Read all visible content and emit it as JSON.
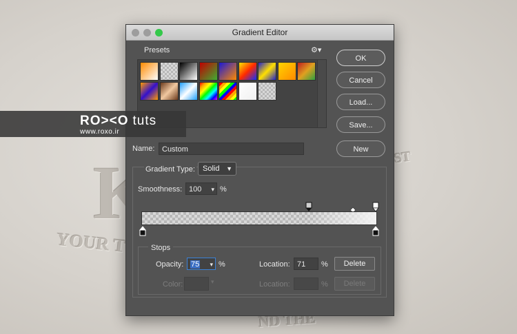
{
  "dialog": {
    "title": "Gradient Editor"
  },
  "presets": {
    "label": "Presets",
    "swatches": [
      "linear-gradient(135deg,#ff8a00,#fff)",
      "checker-fade",
      "linear-gradient(135deg,#000,#fff)",
      "linear-gradient(135deg,#c00000,#3fae32)",
      "linear-gradient(135deg,#1a1ad6,#ff8a00)",
      "linear-gradient(135deg,#ffe400,#ff2a00,#1030ff)",
      "linear-gradient(135deg,#2222cc,#ffe000,#2222cc)",
      "linear-gradient(135deg,#ffd400,#ff8a00)",
      "linear-gradient(135deg,#c02020,#e0a020,#30a040)",
      "linear-gradient(135deg,#ff9900,#3311cc,#ff9900)",
      "linear-gradient(135deg,#6b3a1c,#f0c8a0,#6b3a1c)",
      "linear-gradient(135deg,#20a0ff,#ffffff,#20a0ff)",
      "linear-gradient(135deg,red,orange,yellow,lime,cyan,blue,magenta)",
      "repeating-linear-gradient(135deg,red 0 4px,orange 4px 8px,yellow 8px 12px,lime 12px 16px,blue 16px 20px)",
      "linear-gradient(135deg,#ffffff,#f0f0f0)",
      "checker-fade"
    ]
  },
  "buttons": {
    "ok": "OK",
    "cancel": "Cancel",
    "load": "Load...",
    "save": "Save...",
    "new": "New"
  },
  "name": {
    "label": "Name:",
    "value": "Custom"
  },
  "gradient_type": {
    "label": "Gradient Type:",
    "value": "Solid"
  },
  "smoothness": {
    "label": "Smoothness:",
    "value": "100",
    "unit": "%"
  },
  "stops": {
    "label": "Stops",
    "opacity": {
      "label": "Opacity:",
      "value": "75",
      "unit": "%"
    },
    "location_top": {
      "label": "Location:",
      "value": "71",
      "unit": "%"
    },
    "delete_top": "Delete",
    "color": {
      "label": "Color:"
    },
    "location_bottom": {
      "label": "Location:",
      "value": "",
      "unit": "%"
    },
    "delete_bottom": "Delete"
  },
  "watermark": {
    "logo": "RO><O",
    "tuts": "tuts",
    "url": "www.roxo.ir"
  },
  "background_text": {
    "line1": "YOUR T",
    "line2": "ND THE",
    "right": "ST"
  },
  "colors": {
    "dialog_bg": "#535353",
    "traffic_close": "#fc615d",
    "traffic_min": "#fdbc40",
    "traffic_max": "#34c84a"
  }
}
